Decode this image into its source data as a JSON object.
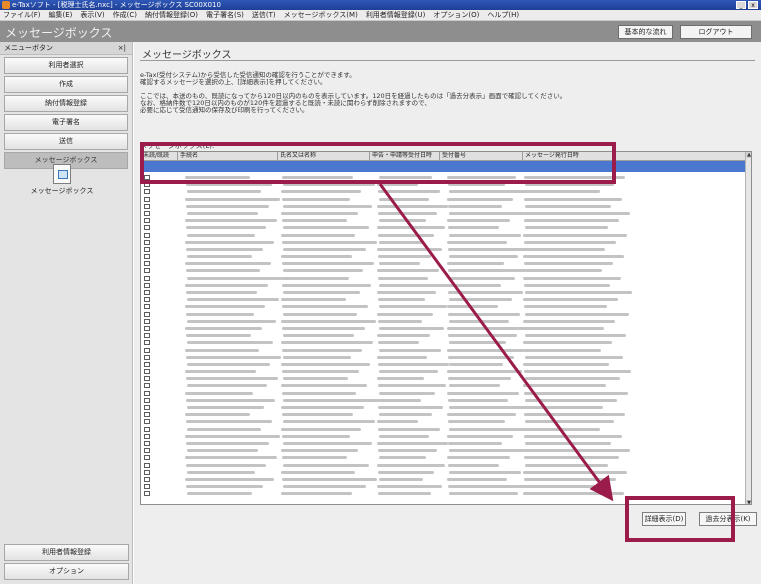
{
  "window": {
    "title": "e-Taxソフト - [税理士氏名.nxc] - メッセージボックス SC00X010",
    "min_label": "_",
    "close_label": "x"
  },
  "menu": [
    "ファイル(F)",
    "編集(E)",
    "表示(V)",
    "作成(C)",
    "納付情報登録(O)",
    "電子署名(S)",
    "送信(T)",
    "メッセージボックス(M)",
    "利用者情報登録(U)",
    "オプション(O)",
    "ヘルプ(H)"
  ],
  "header": {
    "title": "メッセージボックス",
    "basic_flow_label": "基本的な流れ",
    "logout_label": "ログアウト"
  },
  "sidebar": {
    "heading": "メニューボタン",
    "pin_label": "×|",
    "items": [
      "利用者選択",
      "作成",
      "納付情報登録",
      "電子署名",
      "送信",
      "メッセージボックス"
    ],
    "active_index": 5,
    "tool_label": "メッセージボックス",
    "bottom_items": [
      "利用者情報登録",
      "オプション"
    ]
  },
  "main": {
    "title": "メッセージボックス",
    "desc1": "e-Tax(受付システム)から受信した受信通知の確認を行うことができます。",
    "desc2": "確認するメッセージを選択の上、[詳細表示]を押してください。",
    "desc3": "ここでは、本送のもの、既読になってから120日以内のものを表示しています。120日を経過したものは「過去分表示」画面で確認してください。",
    "desc4": "なお、格納件数で120日以内のものが120件を超過すると既読・未読に関わらず削除されますので、",
    "desc5": "必要に応じて受信通知の保存及び印刷を行ってください。",
    "list_label": "メッセージボックス(L):",
    "columns": [
      "未読/既読",
      "手続名",
      "氏名又は名称",
      "申告・申請等受付日時",
      "受付番号",
      "メッセージ発行日時"
    ],
    "detail_button": "詳細表示(D)",
    "past_button": "過去分表示(K)"
  }
}
